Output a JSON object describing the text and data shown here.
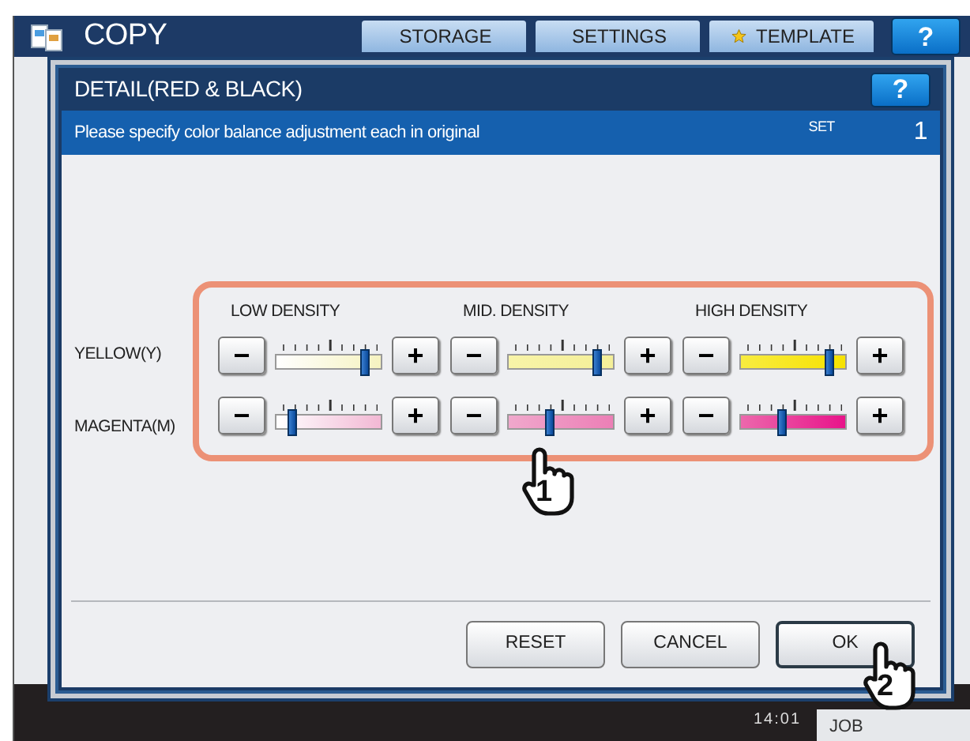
{
  "app": {
    "title": "COPY",
    "tabs": [
      {
        "label": "STORAGE",
        "kind": "plain"
      },
      {
        "label": "SETTINGS",
        "kind": "plain"
      },
      {
        "label": "TEMPLATE",
        "kind": "star"
      }
    ],
    "help": "?"
  },
  "dialog": {
    "title": "DETAIL(RED & BLACK)",
    "help": "?",
    "message": "Please specify color balance adjustment each in original",
    "set_label": "SET",
    "set_value": "1",
    "columns": [
      "LOW DENSITY",
      "MID. DENSITY",
      "HIGH DENSITY"
    ],
    "rows": [
      {
        "label": "YELLOW(Y)",
        "sliders": [
          {
            "minus": "−",
            "plus": "+",
            "level": 0.85
          },
          {
            "minus": "−",
            "plus": "+",
            "level": 0.85
          },
          {
            "minus": "−",
            "plus": "+",
            "level": 0.85
          }
        ]
      },
      {
        "label": "MAGENTA(M)",
        "sliders": [
          {
            "minus": "−",
            "plus": "+",
            "level": 0.15
          },
          {
            "minus": "−",
            "plus": "+",
            "level": 0.4
          },
          {
            "minus": "−",
            "plus": "+",
            "level": 0.4
          }
        ]
      }
    ],
    "buttons": [
      "RESET",
      "CANCEL",
      "OK"
    ]
  },
  "callouts": [
    "1",
    "2"
  ],
  "footer": {
    "time": "14:01",
    "job_status": "JOB"
  }
}
